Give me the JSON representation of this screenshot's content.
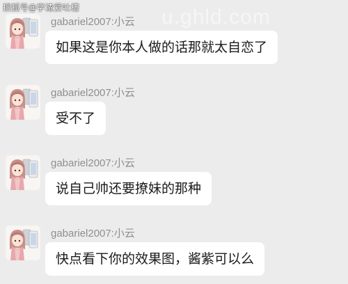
{
  "watermark": "搜狐号@学渣爱吐槽",
  "faint_watermark": "u.ghld.com",
  "messages": [
    {
      "sender": "gabariel2007:小云",
      "text": "如果这是你本人做的话那就太自恋了"
    },
    {
      "sender": "gabariel2007:小云",
      "text": "受不了"
    },
    {
      "sender": "gabariel2007:小云",
      "text": "说自己帅还要撩妹的那种"
    },
    {
      "sender": "gabariel2007:小云",
      "text": "快点看下你的效果图，酱紫可以么"
    }
  ],
  "colors": {
    "background": "#ececec",
    "bubble": "#ffffff",
    "sender_text": "#8f8f8f",
    "message_text": "#1a1a1a"
  },
  "icons": {
    "avatar": "avatar-anime-girl-with-phones"
  }
}
